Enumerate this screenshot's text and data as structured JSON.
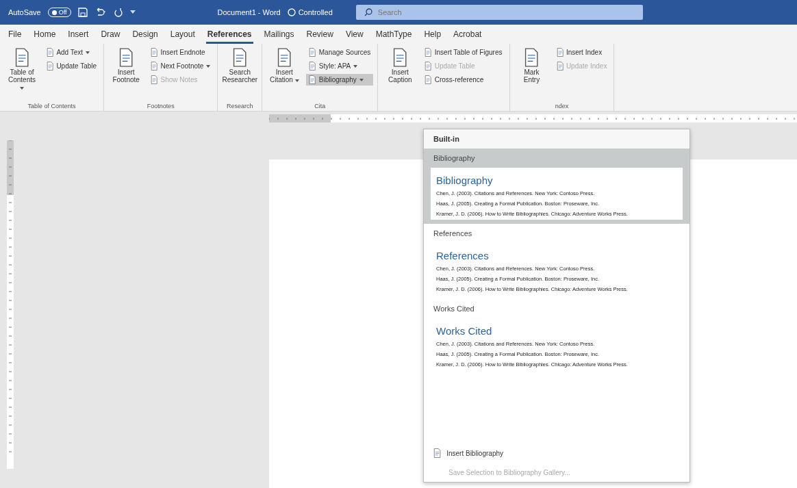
{
  "title_bar": {
    "autosave_label": "AutoSave",
    "autosave": {
      "label": "Off",
      "on": false
    },
    "document_title": "Document1 - Word",
    "status": "Controlled",
    "search": {
      "placeholder": "Search"
    }
  },
  "tabs": [
    {
      "label": "File",
      "selected": false
    },
    {
      "label": "Home",
      "selected": false
    },
    {
      "label": "Insert",
      "selected": false
    },
    {
      "label": "Draw",
      "selected": false
    },
    {
      "label": "Design",
      "selected": false
    },
    {
      "label": "Layout",
      "selected": false
    },
    {
      "label": "References",
      "selected": true
    },
    {
      "label": "Mailings",
      "selected": false
    },
    {
      "label": "Review",
      "selected": false
    },
    {
      "label": "View",
      "selected": false
    },
    {
      "label": "MathType",
      "selected": false
    },
    {
      "label": "Help",
      "selected": false
    },
    {
      "label": "Acrobat",
      "selected": false
    }
  ],
  "ribbon": {
    "groups": [
      {
        "label": "Table of Contents",
        "large": [
          {
            "label": "Table of Contents",
            "dropdown": true
          }
        ],
        "small": [
          {
            "label": "Add Text",
            "dropdown": true,
            "disabled": false
          },
          {
            "label": "Update Table",
            "dropdown": false,
            "disabled": false
          }
        ]
      },
      {
        "label": "Footnotes",
        "large": [
          {
            "label": "Insert Footnote",
            "dropdown": false
          }
        ],
        "small": [
          {
            "label": "Insert Endnote",
            "dropdown": false,
            "disabled": false
          },
          {
            "label": "Next Footnote",
            "dropdown": true,
            "disabled": false
          },
          {
            "label": "Show Notes",
            "dropdown": false,
            "disabled": true
          }
        ]
      },
      {
        "label": "Research",
        "large": [
          {
            "label": "Search Researcher",
            "dropdown": false
          }
        ]
      },
      {
        "label": "Cita",
        "large": [
          {
            "label": "Insert Citation",
            "dropdown": true
          }
        ],
        "small": [
          {
            "label": "Manage Sources",
            "dropdown": false,
            "disabled": false
          },
          {
            "label": "Style: APA",
            "dropdown": true,
            "disabled": false
          },
          {
            "label": "Bibliography",
            "dropdown": true,
            "disabled": false,
            "pressed": true
          }
        ]
      },
      {
        "large": [
          {
            "label": "Insert Caption",
            "dropdown": false
          }
        ],
        "small": [
          {
            "label": "Insert Table of Figures",
            "dropdown": false,
            "disabled": false
          },
          {
            "label": "Update Table",
            "dropdown": false,
            "disabled": true
          },
          {
            "label": "Cross-reference",
            "dropdown": false,
            "disabled": false
          }
        ]
      },
      {
        "label": "ndex",
        "large": [
          {
            "label": "Mark Entry",
            "dropdown": false
          }
        ],
        "small": [
          {
            "label": "Insert Index",
            "dropdown": false,
            "disabled": false
          },
          {
            "label": "Update Index",
            "dropdown": false,
            "disabled": true
          }
        ]
      }
    ]
  },
  "bibliography_menu": {
    "header": "Built-in",
    "styles": [
      {
        "name": "Bibliography",
        "selected": true,
        "title": "Bibliography",
        "entries": [
          "Chen, J. (2003). Citations and References. New York: Contoso Press.",
          "Haas, J. (2005). Creating a Formal Publication. Boston: Proseware, Inc.",
          "Kramer, J. D. (2006). How to Write Bibliographies. Chicago: Adventure Works Press."
        ]
      },
      {
        "name": "References",
        "selected": false,
        "title": "References",
        "entries": [
          "Chen, J. (2003). Citations and References. New York: Contoso Press.",
          "Haas, J. (2005). Creating a Formal Publication. Boston: Proseware, Inc.",
          "Kramer, J. D. (2006). How to Write Bibliographies. Chicago: Adventure Works Press."
        ]
      },
      {
        "name": "Works Cited",
        "selected": false,
        "title": "Works Cited",
        "entries": [
          "Chen, J. (2003). Citations and References. New York: Contoso Press.",
          "Haas, J. (2005). Creating a Formal Publication. Boston: Proseware, Inc.",
          "Kramer, J. D. (2006). How to Write Bibliographies. Chicago: Adventure Works Press."
        ]
      }
    ],
    "actions": [
      {
        "label": "Insert Bibliography",
        "disabled": false
      },
      {
        "label": "Save Selection to Bibliography Gallery...",
        "disabled": true
      }
    ]
  }
}
